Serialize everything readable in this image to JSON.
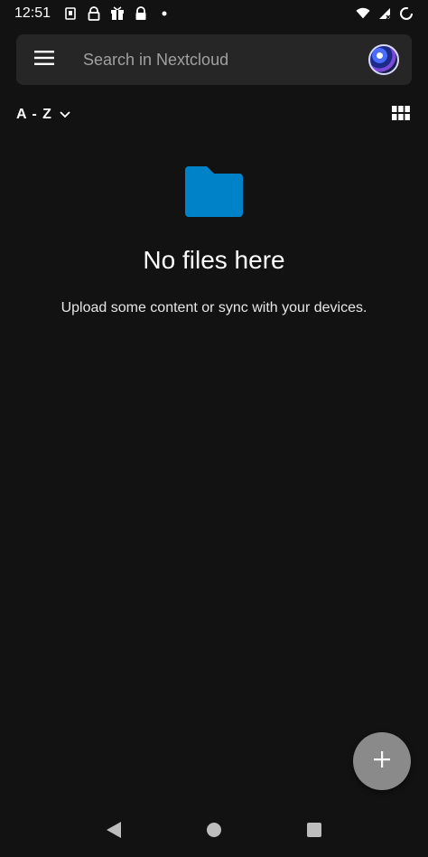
{
  "status_bar": {
    "time": "12:51",
    "icons_left": [
      "sim-icon",
      "lock-icon",
      "gift-icon",
      "lock-icon",
      "dot-icon"
    ],
    "icons_right": [
      "wifi-icon",
      "signal-icon",
      "battery-icon"
    ]
  },
  "search": {
    "placeholder": "Search in Nextcloud"
  },
  "sort": {
    "label": "A - Z"
  },
  "empty_state": {
    "title": "No files here",
    "subtitle": "Upload some content or sync with your devices."
  },
  "fab": {
    "icon": "plus-icon"
  },
  "nav": {
    "back": "back-icon",
    "home": "home-icon",
    "recents": "recents-icon"
  },
  "colors": {
    "background": "#121212",
    "surface": "#262626",
    "folder": "#0082c9",
    "fab": "#8a8a8a"
  }
}
